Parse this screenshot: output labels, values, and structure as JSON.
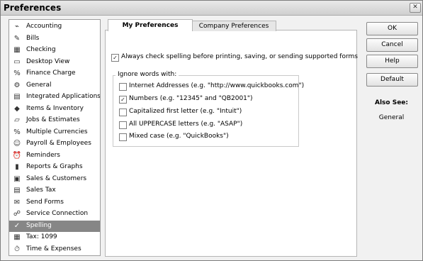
{
  "window": {
    "title": "Preferences",
    "close_label": "✕"
  },
  "sidebar": {
    "items": [
      {
        "label": "Accounting",
        "icon": "⌁"
      },
      {
        "label": "Bills",
        "icon": "✎"
      },
      {
        "label": "Checking",
        "icon": "▦"
      },
      {
        "label": "Desktop View",
        "icon": "▭"
      },
      {
        "label": "Finance Charge",
        "icon": "%"
      },
      {
        "label": "General",
        "icon": "⚙"
      },
      {
        "label": "Integrated Applications",
        "icon": "▤"
      },
      {
        "label": "Items & Inventory",
        "icon": "◆"
      },
      {
        "label": "Jobs & Estimates",
        "icon": "▱"
      },
      {
        "label": "Multiple Currencies",
        "icon": "%"
      },
      {
        "label": "Payroll & Employees",
        "icon": "☺"
      },
      {
        "label": "Reminders",
        "icon": "⏰"
      },
      {
        "label": "Reports & Graphs",
        "icon": "▮"
      },
      {
        "label": "Sales & Customers",
        "icon": "▣"
      },
      {
        "label": "Sales Tax",
        "icon": "▤"
      },
      {
        "label": "Send Forms",
        "icon": "✉"
      },
      {
        "label": "Service Connection",
        "icon": "☍"
      },
      {
        "label": "Spelling",
        "icon": "✓"
      },
      {
        "label": "Tax: 1099",
        "icon": "▦"
      },
      {
        "label": "Time & Expenses",
        "icon": "⏱"
      }
    ],
    "selected": "Spelling"
  },
  "tabs": {
    "my_preferences": "My Preferences",
    "company_preferences": "Company Preferences"
  },
  "main": {
    "always_check": {
      "label": "Always check spelling before printing, saving, or sending supported forms",
      "checked": true
    },
    "ignore_group_title": "Ignore words with:",
    "ignore_options": [
      {
        "label": "Internet Addresses (e.g. \"http://www.quickbooks.com\")",
        "checked": false
      },
      {
        "label": "Numbers (e.g. \"12345\" and \"QB2001\")",
        "checked": true
      },
      {
        "label": "Capitalized first letter (e.g. \"Intuit\")",
        "checked": false
      },
      {
        "label": "All UPPERCASE letters (e.g. \"ASAP\")",
        "checked": false
      },
      {
        "label": "Mixed case (e.g. \"QuickBooks\")",
        "checked": false
      }
    ]
  },
  "buttons": {
    "ok": "OK",
    "cancel": "Cancel",
    "help": "Help",
    "default": "Default"
  },
  "also_see": {
    "title": "Also See:",
    "link": "General"
  }
}
